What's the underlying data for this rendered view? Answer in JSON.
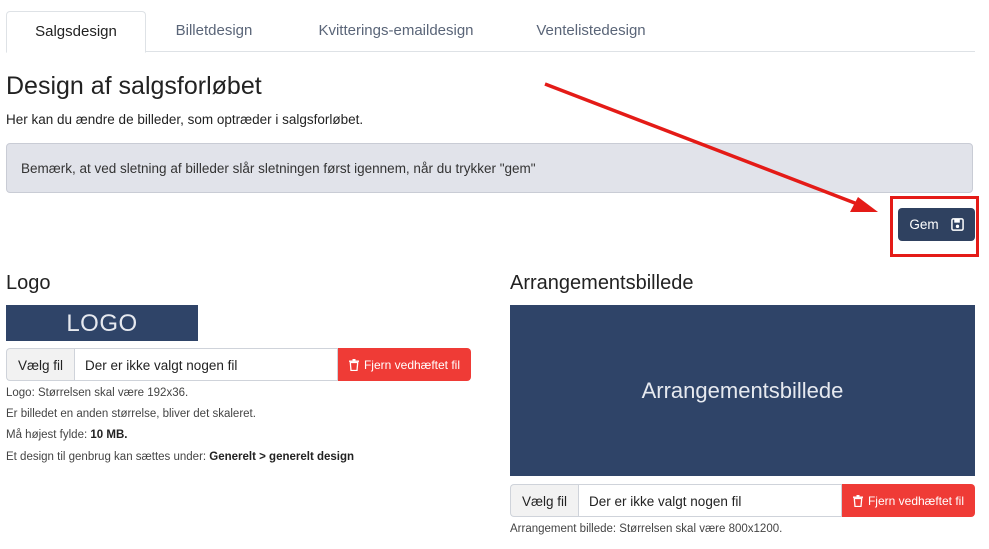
{
  "tabs": [
    {
      "label": "Salgsdesign",
      "active": true
    },
    {
      "label": "Billetdesign",
      "active": false
    },
    {
      "label": "Kvitterings-emaildesign",
      "active": false
    },
    {
      "label": "Ventelistedesign",
      "active": false
    }
  ],
  "page": {
    "title": "Design af salgsforløbet",
    "subtitle": "Her kan du ændre de billeder, som optræder i salgsforløbet.",
    "notice": "Bemærk, at ved sletning af billeder slår sletningen først igennem, når du trykker \"gem\""
  },
  "save": {
    "label": "Gem",
    "icon": "floppy-disk-icon"
  },
  "annotation": {
    "color": "#e41b17"
  },
  "logo": {
    "title": "Logo",
    "preview_text": "LOGO",
    "choose_label": "Vælg fil",
    "file_text": "Der er ikke valgt nogen fil",
    "remove_label": "Fjern vedhæftet fil",
    "hint_size": "Logo: Størrelsen skal være 192x36.",
    "hint_scale": "Er billedet en anden størrelse, bliver det skaleret.",
    "hint_max_prefix": "Må højest fylde:",
    "hint_max_value": "10 MB.",
    "hint_reuse_prefix": "Et design til genbrug kan sættes under:",
    "hint_reuse_link": "Generelt > generelt design"
  },
  "event_image": {
    "title": "Arrangementsbillede",
    "preview_text": "Arrangementsbillede",
    "choose_label": "Vælg fil",
    "file_text": "Der er ikke valgt nogen fil",
    "remove_label": "Fjern vedhæftet fil",
    "hint_size": "Arrangement billede: Størrelsen skal være 800x1200."
  },
  "colors": {
    "primary": "#2f4160",
    "danger": "#ef3b36",
    "preview_bg": "#2f4468",
    "notice_bg": "#e1e3ea"
  }
}
